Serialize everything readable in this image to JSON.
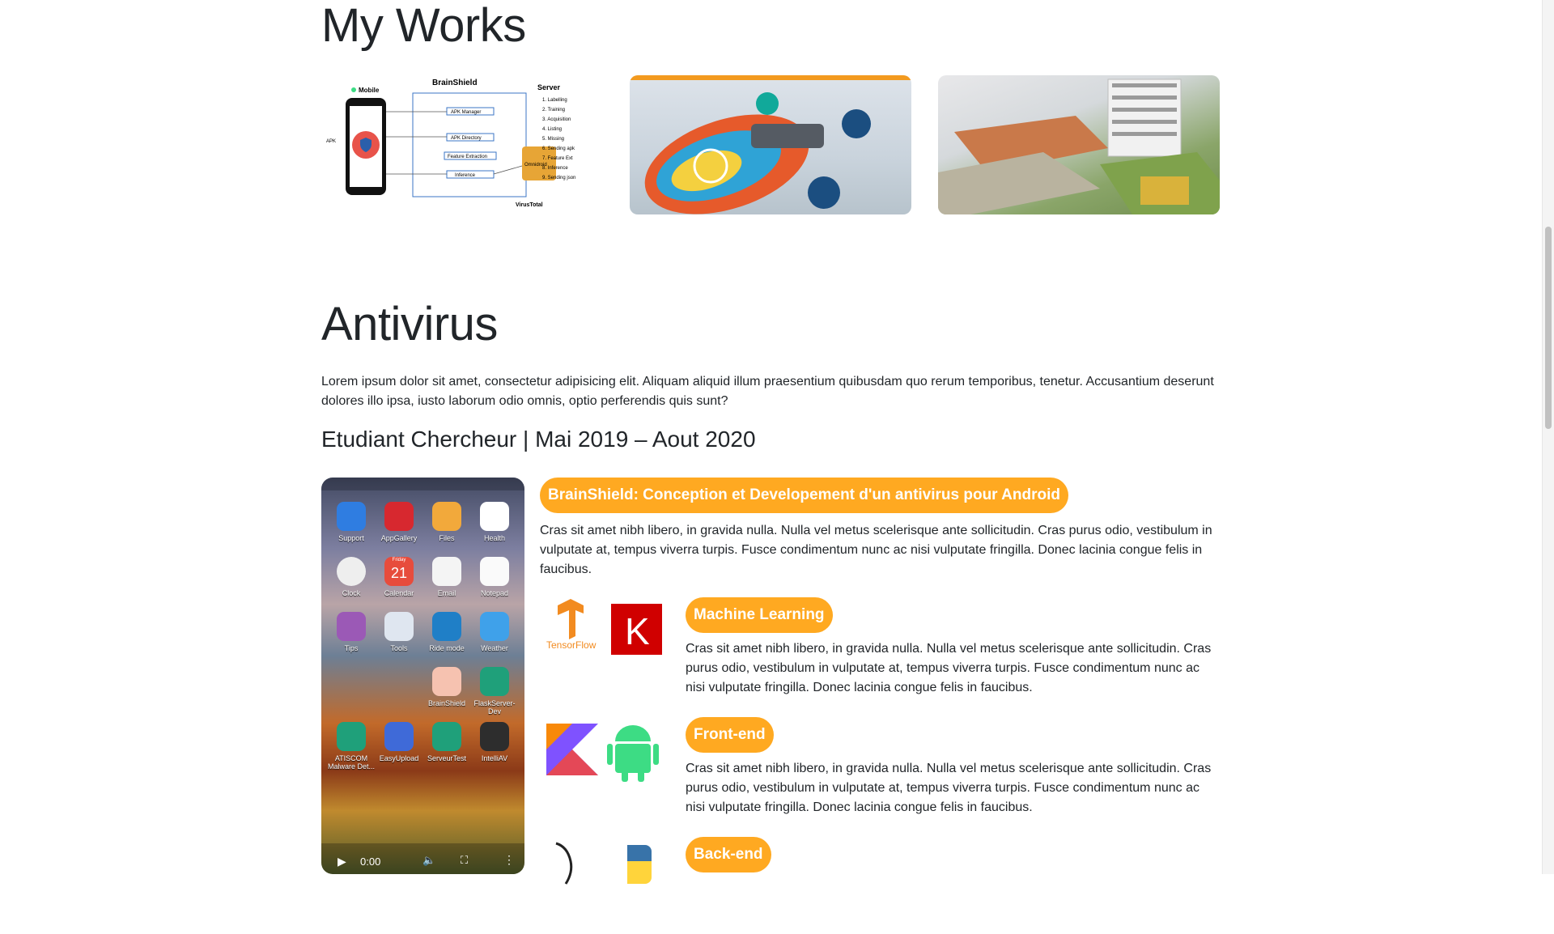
{
  "works": {
    "title": "My Works",
    "diagram": {
      "mobile": "Mobile",
      "title": "BrainShield",
      "server": "Server",
      "boxes": [
        "APK Manager",
        "APK Directory",
        "Feature Extraction",
        "Inference"
      ],
      "db": "Omnidroid",
      "list": [
        "1. Labelling",
        "2. Training",
        "3. Acquisition",
        "4. Listing",
        "5. Missing",
        "6. Sending apk",
        "7. Feature Ext",
        "8. Inference",
        "9. Sending json"
      ],
      "apk": "APK",
      "virustotal": "VirusTotal"
    }
  },
  "section": {
    "title": "Antivirus",
    "intro": "Lorem ipsum dolor sit amet, consectetur adipisicing elit. Aliquam aliquid illum praesentium quibusdam quo rerum temporibus, tenetur. Accusantium deserunt dolores illo ipsa, iusto laborum odio omnis, optio perferendis quis sunt?",
    "role": "Etudiant Chercheur | Mai 2019 – Aout 2020"
  },
  "phone": {
    "apps": [
      {
        "label": "Support",
        "color": "#2f7de1"
      },
      {
        "label": "AppGallery",
        "color": "#d7282f"
      },
      {
        "label": "Files",
        "color": "#f2a93b"
      },
      {
        "label": "Health",
        "color": "#ffffff"
      },
      {
        "label": "Clock",
        "color": "#eeeeee"
      },
      {
        "label": "Calendar",
        "color": "#e74c3c"
      },
      {
        "label": "Email",
        "color": "#f4f4f4"
      },
      {
        "label": "Notepad",
        "color": "#fafafa"
      },
      {
        "label": "Tips",
        "color": "#9b59b6"
      },
      {
        "label": "Tools",
        "color": "#dfe6f0"
      },
      {
        "label": "Ride mode",
        "color": "#1f7fc7"
      },
      {
        "label": "Weather",
        "color": "#3fa1ea"
      },
      {
        "label": "BrainShield",
        "color": "#f6c2b0"
      },
      {
        "label": "FlaskServer-Dev",
        "color": "#1fa07a"
      },
      {
        "label": "ATISCOM Malware Det...",
        "color": "#1fa07a"
      },
      {
        "label": "EasyUpload",
        "color": "#3f6ad8"
      },
      {
        "label": "ServeurTest",
        "color": "#1fa07a"
      },
      {
        "label": "IntelliAV",
        "color": "#2d2d2d"
      }
    ],
    "calendar_day": "Friday",
    "calendar_date": "21",
    "video_time": "0:00"
  },
  "project": {
    "title": "BrainShield: Conception et Developement d'un antivirus pour Android",
    "description": "Cras sit amet nibh libero, in gravida nulla. Nulla vel metus scelerisque ante sollicitudin. Cras purus odio, vestibulum in vulputate at, tempus viverra turpis. Fusce condimentum nunc ac nisi vulputate fringilla. Donec lacinia congue felis in faucibus."
  },
  "features": [
    {
      "title": "Machine Learning",
      "text": "Cras sit amet nibh libero, in gravida nulla. Nulla vel metus scelerisque ante sollicitudin. Cras purus odio, vestibulum in vulputate at, tempus viverra turpis. Fusce condimentum nunc ac nisi vulputate fringilla. Donec lacinia congue felis in faucibus.",
      "logo1": "TensorFlow",
      "logo2": "K"
    },
    {
      "title": "Front-end",
      "text": "Cras sit amet nibh libero, in gravida nulla. Nulla vel metus scelerisque ante sollicitudin. Cras purus odio, vestibulum in vulputate at, tempus viverra turpis. Fusce condimentum nunc ac nisi vulputate fringilla. Donec lacinia congue felis in faucibus."
    },
    {
      "title": "Back-end"
    }
  ],
  "colors": {
    "accent": "#ffa921",
    "text": "#212529",
    "tensorflow": "#f28b20",
    "keras": "#d00000",
    "android": "#3ddc84",
    "python_blue": "#3873a9",
    "python_yellow": "#ffd43b"
  }
}
